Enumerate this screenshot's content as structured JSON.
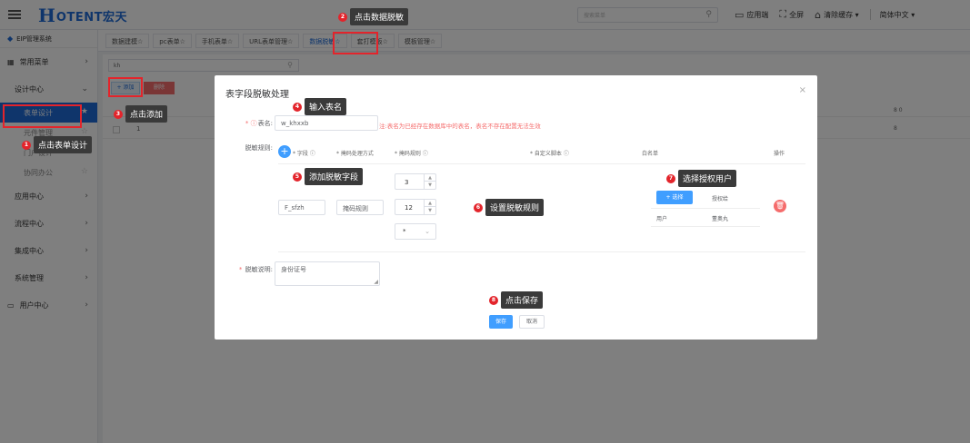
{
  "header": {
    "logo_mark": "H",
    "logo_text": "OTENT宏天",
    "search_placeholder": "搜索菜单",
    "tools": [
      {
        "icon": "monitor-icon",
        "glyph": "🖵",
        "label": "应用端"
      },
      {
        "icon": "fullscreen-icon",
        "glyph": "⛶",
        "label": "全屏"
      },
      {
        "icon": "clear-cache-icon",
        "glyph": "🗑",
        "label": "清除缓存 ▾"
      },
      {
        "icon": "language-icon",
        "glyph": "",
        "label": "简体中文 ▾"
      }
    ]
  },
  "sidebar": {
    "system_title": "EIP管理系统",
    "common_menu": "常用菜单",
    "design_center": "设计中心",
    "sub_items": [
      "表单设计",
      "元件管理",
      "门户设计",
      "协同办公"
    ],
    "items": [
      "应用中心",
      "流程中心",
      "集成中心",
      "系统管理",
      "用户中心"
    ]
  },
  "tabs": [
    "数据建模☆",
    "pc表单☆",
    "手机表单☆",
    "URL表单管理☆",
    "数据脱敏☆",
    "套打模板☆",
    "模板管理☆"
  ],
  "content": {
    "search_value": "kh",
    "add_label": "+ 添加",
    "delete_label": "删除",
    "row_number": "1",
    "right_a": "8 0",
    "right_b": "8"
  },
  "dialog": {
    "title": "表字段脱敏处理",
    "close": "×",
    "table_label": "表名:",
    "table_value": "w_khxxb",
    "table_hint": "注:表名为已经存在数据库中的表名，表名不存在配置无法生效",
    "rules_label": "脱敏规则:",
    "columns": {
      "field": "* 字段",
      "method": "* 掩码处理方式",
      "rule": "* 掩码规则",
      "script": "* 自定义脚本",
      "whitelist": "白名单",
      "action": "操作"
    },
    "field_value": "F_sfzh",
    "method_value": "掩码规则",
    "rule_start": "3",
    "rule_length": "12",
    "mask_char": "*",
    "select_button": "+ 选择",
    "authorize_label": "授权给",
    "user_type": "用户",
    "user_name": "董奥丸",
    "desc_label": "脱敏说明:",
    "desc_value": "身份证号",
    "save": "保存",
    "cancel": "取消"
  },
  "callouts": [
    {
      "num": "1",
      "text": "点击表单设计"
    },
    {
      "num": "2",
      "text": "点击数据脱敏"
    },
    {
      "num": "3",
      "text": "点击添加"
    },
    {
      "num": "4",
      "text": "输入表名"
    },
    {
      "num": "5",
      "text": "添加脱敏字段"
    },
    {
      "num": "6",
      "text": "设置脱敏规则"
    },
    {
      "num": "7",
      "text": "选择授权用户"
    },
    {
      "num": "8",
      "text": "点击保存"
    }
  ],
  "colors": {
    "primary": "#1e6bd6",
    "accent": "#409eff",
    "danger": "#f56c6c",
    "annotation": "#e3242b"
  }
}
